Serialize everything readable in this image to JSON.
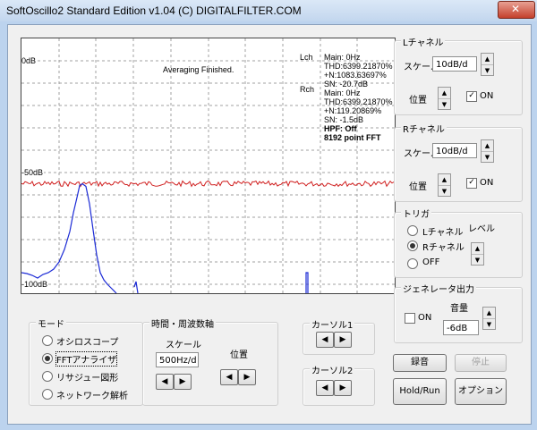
{
  "window": {
    "title": "SoftOscillo2 Standard Edition v1.04 (C) DIGITALFILTER.COM",
    "close_glyph": "✕"
  },
  "scope": {
    "status": "Averaging Finished.",
    "y_labels": [
      "0dB",
      "-50dB",
      "-100dB"
    ],
    "lch_label": "Lch",
    "lch_lines": [
      "Main:    0Hz",
      "THD:6399.21870%",
      "+N:1083.63697%",
      "SN:   -20.7dB"
    ],
    "rch_label": "Rch",
    "rch_lines": [
      "Main:    0Hz",
      "THD:6399.21870%",
      "+N:119.20869%",
      "SN:   -1.5dB"
    ],
    "hpf": "HPF: Off",
    "fft": "8192 point FFT"
  },
  "chart_data": {
    "type": "line",
    "ylim": [
      -100,
      0
    ],
    "y_ticks": [
      "0dB",
      "-50dB",
      "-100dB"
    ],
    "grid": true,
    "series": [
      {
        "color": "#d02020",
        "level_db": -55
      },
      {
        "color": "#1c2bd6",
        "peak_db": -55
      }
    ]
  },
  "lch": {
    "title": "Lチャネル",
    "scale_label": "スケール",
    "scale_value": "10dB/d",
    "pos_label": "位置",
    "on_label": "ON",
    "on_checked": "✓"
  },
  "rch": {
    "title": "Rチャネル",
    "scale_label": "スケール",
    "scale_value": "10dB/d",
    "pos_label": "位置",
    "on_label": "ON",
    "on_checked": "✓"
  },
  "trigger": {
    "title": "トリガ",
    "options": [
      "Lチャネル",
      "Rチャネル",
      "OFF"
    ],
    "level_label": "レベル"
  },
  "generator": {
    "title": "ジェネレータ出力",
    "on_label": "ON",
    "volume_label": "音量",
    "volume_value": "-6dB"
  },
  "mode": {
    "title": "モード",
    "options": [
      "オシロスコープ",
      "FFTアナライザ",
      "リサジュー図形",
      "ネットワーク解析"
    ]
  },
  "time": {
    "title": "時間・周波数軸",
    "scale_label": "スケール",
    "scale_value": "500Hz/d",
    "pos_label": "位置"
  },
  "cursor1": {
    "title": "カーソル1"
  },
  "cursor2": {
    "title": "カーソル2"
  },
  "buttons": {
    "record": "録音",
    "stop": "停止",
    "hold": "Hold/Run",
    "options": "オプション"
  },
  "glyphs": {
    "left": "◀",
    "right": "▶",
    "up": "▲",
    "down": "▼"
  },
  "colors": {
    "red_trace": "#d02020",
    "blue_trace": "#1c2bd6",
    "grid": "#a0a0a0"
  }
}
